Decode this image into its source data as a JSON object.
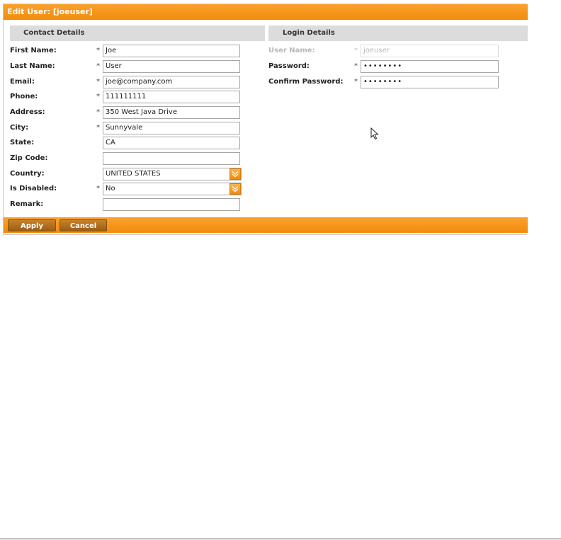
{
  "dialog": {
    "title": "Edit User: [joeuser]"
  },
  "contact": {
    "heading": "Contact Details",
    "fields": [
      {
        "label": "First Name:",
        "required": "*",
        "value": "Joe"
      },
      {
        "label": "Last Name:",
        "required": "*",
        "value": "User"
      },
      {
        "label": "Email:",
        "required": "*",
        "value": "joe@company.com"
      },
      {
        "label": "Phone:",
        "required": "*",
        "value": "111111111"
      },
      {
        "label": "Address:",
        "required": "*",
        "value": "350 West Java Drive"
      },
      {
        "label": "City:",
        "required": "*",
        "value": "Sunnyvale"
      },
      {
        "label": "State:",
        "required": "",
        "value": "CA"
      },
      {
        "label": "Zip Code:",
        "required": "",
        "value": ""
      },
      {
        "label": "Country:",
        "required": "",
        "value": "UNITED STATES"
      },
      {
        "label": "Is Disabled:",
        "required": "*",
        "value": "No"
      },
      {
        "label": "Remark:",
        "required": "",
        "value": ""
      }
    ]
  },
  "login": {
    "heading": "Login Details",
    "fields": [
      {
        "label": "User Name:",
        "required": "*",
        "value": "joeuser",
        "disabled": true
      },
      {
        "label": "Password:",
        "required": "*",
        "value": "••••••••"
      },
      {
        "label": "Confirm Password:",
        "required": "*",
        "value": "••••••••"
      }
    ]
  },
  "buttons": {
    "apply": "Apply",
    "cancel": "Cancel"
  },
  "icons": {
    "select_arrow": "chevron-double-down-icon",
    "cursor": "mouse-pointer-icon"
  },
  "colors": {
    "accent": "#f7941d",
    "button": "#a8661a",
    "section_header": "#dcdcdc"
  }
}
